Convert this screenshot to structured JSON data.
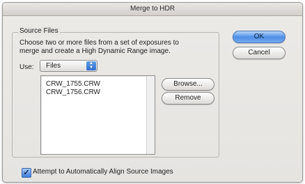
{
  "window": {
    "title": "Merge to HDR"
  },
  "source_files": {
    "group_title": "Source Files",
    "description_line1": "Choose two or more files from a set of exposures to",
    "description_line2": "merge and create a High Dynamic Range image.",
    "use_label": "Use:",
    "use_selected": "Files",
    "files": [
      "CRW_1755.CRW",
      "CRW_1756.CRW"
    ],
    "browse_label": "Browse...",
    "remove_label": "Remove"
  },
  "buttons": {
    "ok_label": "OK",
    "cancel_label": "Cancel"
  },
  "align_option": {
    "label": "Attempt to Automatically Align Source Images",
    "checked": true
  },
  "icons": {
    "select_arrows": "updown-arrows-icon",
    "checkbox_mark": "checkmark-icon"
  },
  "colors": {
    "default_button": "#4e8fe6",
    "dialog_background": "#e8e6e3"
  }
}
